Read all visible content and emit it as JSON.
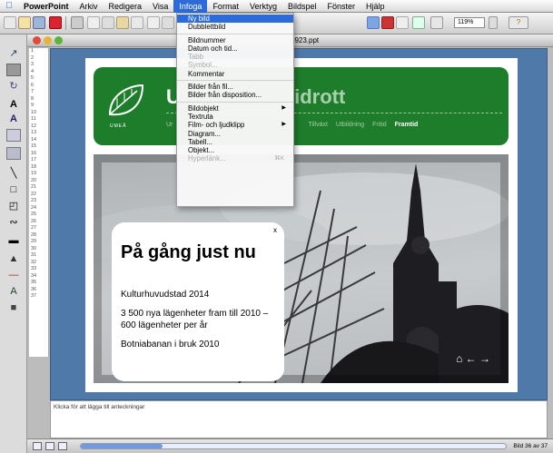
{
  "menubar": {
    "app": "PowerPoint",
    "items": [
      "Arkiv",
      "Redigera",
      "Visa",
      "Infoga",
      "Format",
      "Verktyg",
      "Bildspel",
      "Fönster",
      "Hjälp"
    ],
    "active": "Infoga"
  },
  "toolbar": {
    "zoom": "119%",
    "help_icon": "question-icon"
  },
  "document": {
    "title_fragment": "0923.ppt"
  },
  "outline": {
    "rows": [
      "1",
      "2",
      "3",
      "4",
      "5",
      "6",
      "7",
      "8",
      "9",
      "10",
      "11",
      "12",
      "13",
      "14",
      "15",
      "16",
      "17",
      "18",
      "19",
      "20",
      "21",
      "22",
      "23",
      "24",
      "25",
      "26",
      "27",
      "28",
      "29",
      "30",
      "31",
      "32",
      "33",
      "34",
      "35",
      "36",
      "37"
    ]
  },
  "slide": {
    "header_title": "U",
    "header_title_faded": "/idrott",
    "nav": [
      "Ur",
      "Tillväxt",
      "Utbildning",
      "Fritid",
      "Framtid"
    ],
    "active_nav": "Framtid",
    "box_close": "x",
    "box_heading": "På gång just nu",
    "box_lines": [
      "Kulturhuvudstad 2014",
      "3 500 nya lägenheter fram till 2010 – 600 lägenheter per år",
      "Botniabanan i bruk 2010"
    ],
    "arrows": "⌂ ← →"
  },
  "notes": {
    "placeholder": "Klicka för att lägga till anteckningar"
  },
  "status": {
    "slide_counter": "Bild 36 av 37"
  },
  "menu": {
    "groups": [
      [
        {
          "label": "Ny bild",
          "highlight": true
        },
        {
          "label": "Dubblettbild"
        }
      ],
      [
        {
          "label": "Bildnummer"
        },
        {
          "label": "Datum och tid..."
        },
        {
          "label": "Tabb",
          "disabled": true
        },
        {
          "label": "Symbol...",
          "disabled": true
        },
        {
          "label": "Kommentar"
        }
      ],
      [
        {
          "label": "Bilder från fil..."
        },
        {
          "label": "Bilder från disposition..."
        }
      ],
      [
        {
          "label": "Bildobjekt",
          "submenu": true
        },
        {
          "label": "Textruta"
        },
        {
          "label": "Film- och ljudklipp",
          "submenu": true
        },
        {
          "label": "Diagram..."
        },
        {
          "label": "Tabell..."
        },
        {
          "label": "Objekt..."
        },
        {
          "label": "Hyperlänk...",
          "disabled": true,
          "shortcut": "⌘K"
        }
      ]
    ]
  },
  "colors": {
    "menu_highlight": "#2c6bd9",
    "band_green": "#1e7d2a",
    "stage_blue": "#4f79a9"
  }
}
